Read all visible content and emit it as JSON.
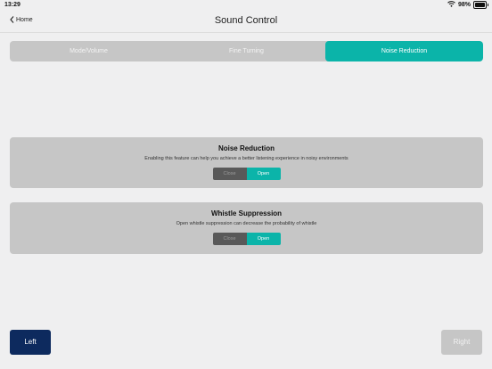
{
  "status_bar": {
    "time": "13:29",
    "battery": "98%",
    "battery_level": 0.98
  },
  "nav": {
    "back_label": "Home",
    "title": "Sound Control"
  },
  "tabs": [
    {
      "label": "Mode/Volume",
      "active": false
    },
    {
      "label": "Fine Turning",
      "active": false
    },
    {
      "label": "Noise Reduction",
      "active": true
    }
  ],
  "cards": [
    {
      "title": "Noise Reduction",
      "description": "Enabling this feature can help you achieve a better listening experience in noisy environments",
      "close_label": "Close",
      "open_label": "Open",
      "selected": "Open"
    },
    {
      "title": "Whistle Suppression",
      "description": "Open whistle suppression can decrease the probability of whistle",
      "close_label": "Close",
      "open_label": "Open",
      "selected": "Open"
    }
  ],
  "footer": {
    "left_label": "Left",
    "right_label": "Right"
  },
  "colors": {
    "accent": "#0bb4a9",
    "navy": "#0d2a5e",
    "panel": "#c6c6c6",
    "background": "#efeff0"
  }
}
